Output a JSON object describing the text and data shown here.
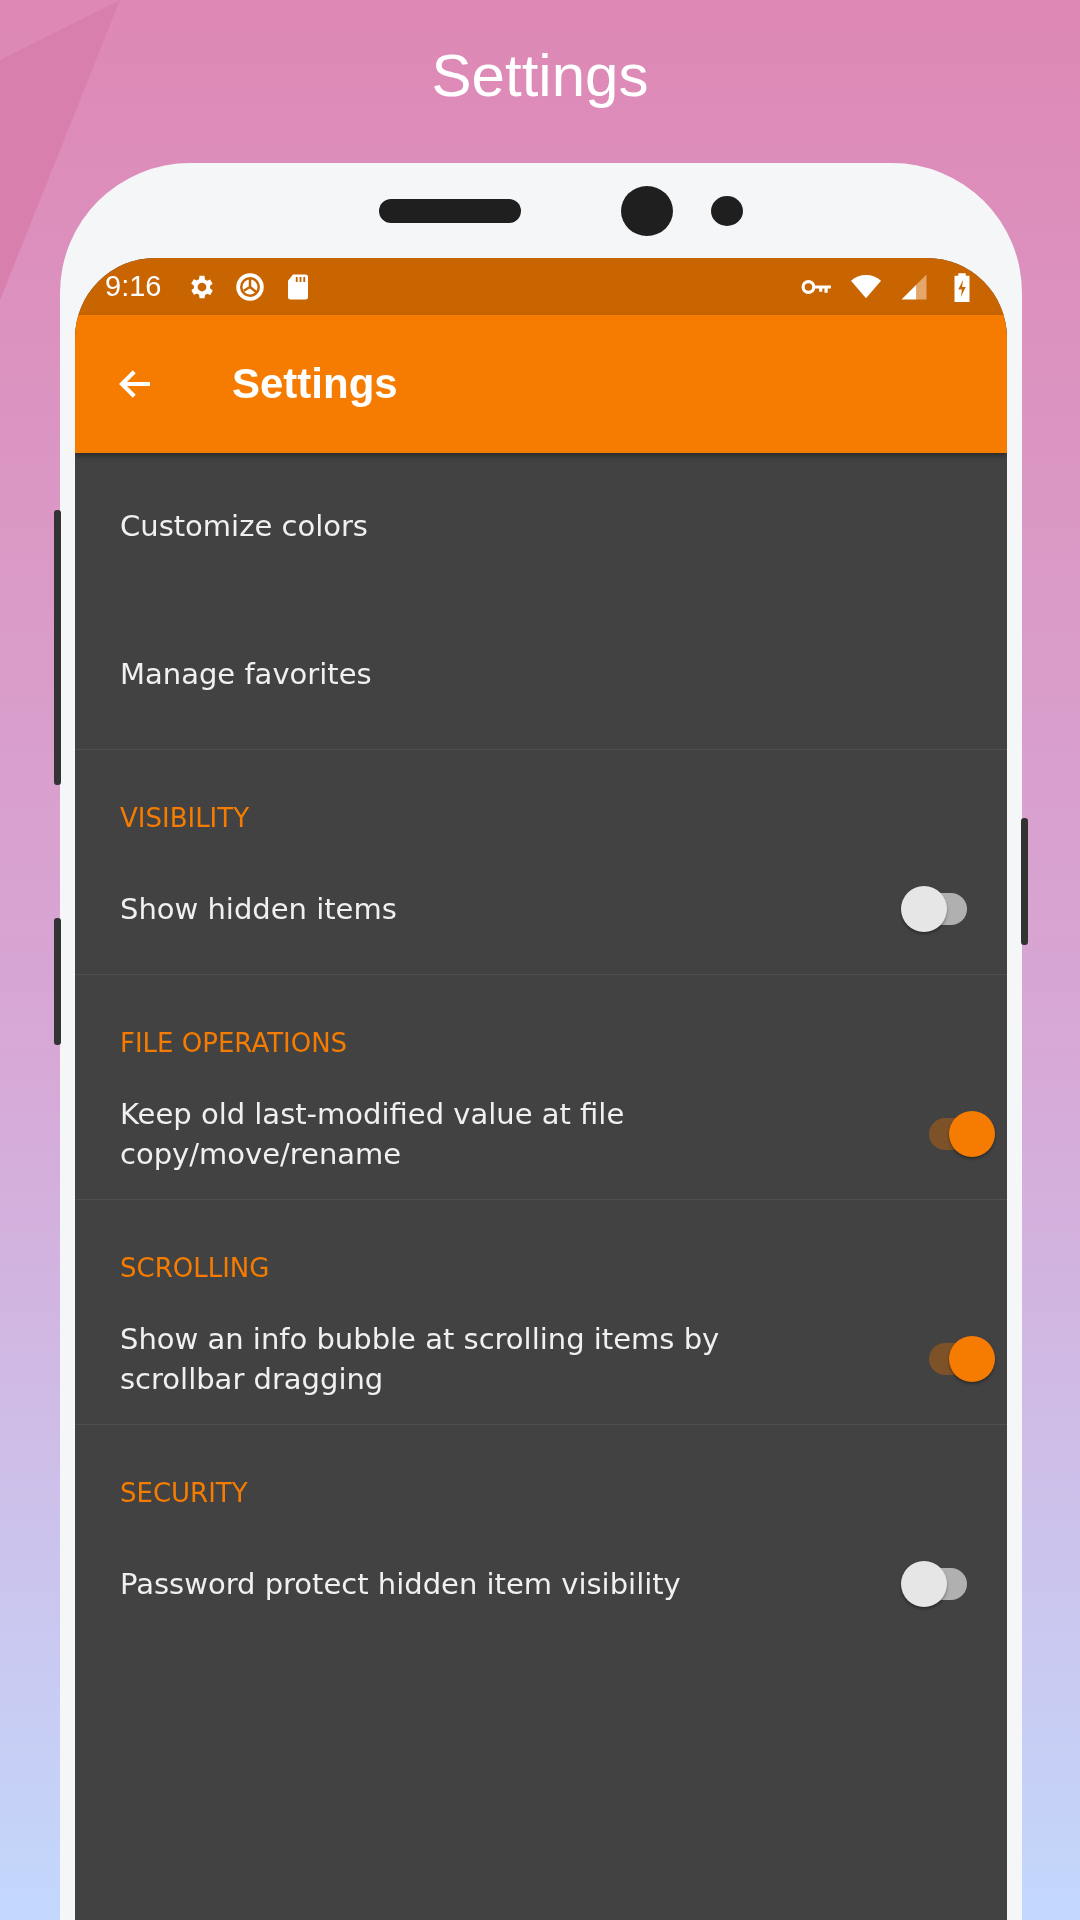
{
  "page_title": "Settings",
  "status_bar": {
    "time": "9:16"
  },
  "app_bar": {
    "title": "Settings"
  },
  "sections": [
    {
      "items": [
        {
          "kind": "link",
          "label": "Customize colors"
        },
        {
          "kind": "link",
          "label": "Manage favorites"
        }
      ]
    },
    {
      "header": "VISIBILITY",
      "items": [
        {
          "kind": "switch",
          "label": "Show hidden items",
          "on": false
        }
      ]
    },
    {
      "header": "FILE OPERATIONS",
      "items": [
        {
          "kind": "switch",
          "label": "Keep old last-modified value at file copy/move/rename",
          "on": true
        }
      ]
    },
    {
      "header": "SCROLLING",
      "items": [
        {
          "kind": "switch",
          "label": "Show an info bubble at scrolling items by scrollbar dragging",
          "on": true
        }
      ]
    },
    {
      "header": "SECURITY",
      "items": [
        {
          "kind": "switch",
          "label": "Password protect hidden item visibility",
          "on": false
        }
      ]
    }
  ]
}
